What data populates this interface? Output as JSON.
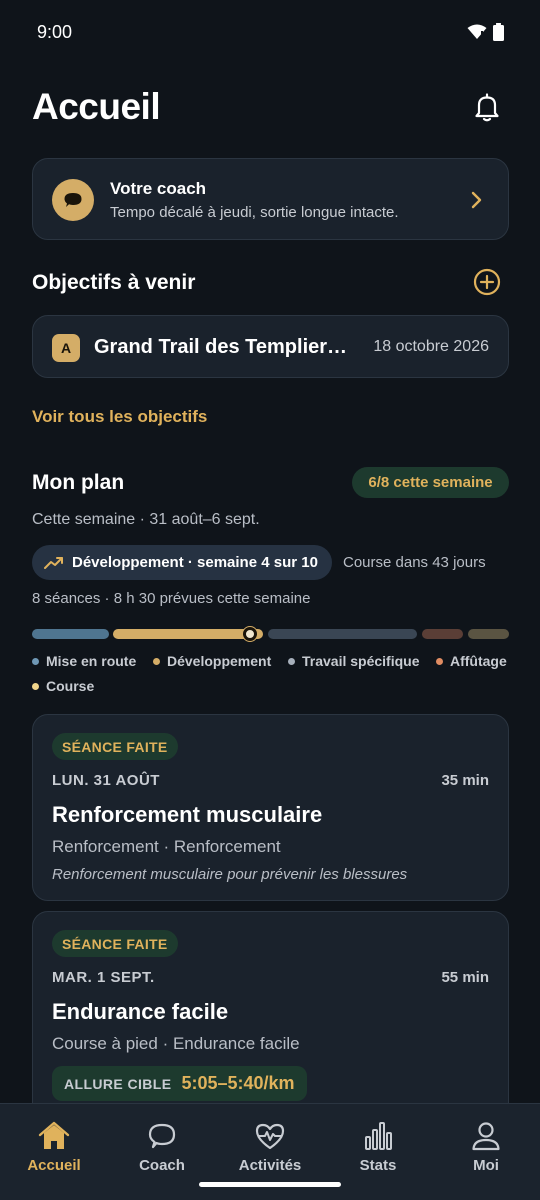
{
  "status_bar": {
    "time": "9:00"
  },
  "header": {
    "title": "Accueil"
  },
  "coach": {
    "title": "Votre coach",
    "message": "Tempo décalé à jeudi, sortie longue intacte."
  },
  "goals": {
    "title": "Objectifs à venir",
    "items": [
      {
        "badge": "A",
        "name": "Grand Trail des Templiers (…",
        "date": "18 octobre 2026"
      }
    ],
    "see_all": "Voir tous les objectifs"
  },
  "plan": {
    "title": "Mon plan",
    "week_progress": "6/8 cette semaine",
    "week_range": "Cette semaine · 31 août–6 sept.",
    "phase": "Développement · semaine 4 sur 10",
    "race_in": "Course dans 43 jours",
    "summary": "8 séances · 8 h 30 prévues cette semaine",
    "phase_colors": {
      "mise_en_route": "#4f7590",
      "developpement": "#d4ad67",
      "travail_specifique": "#3a4654",
      "affutage": "#5a3e36",
      "course": "#5a5442"
    },
    "legend": [
      {
        "label": "Mise en route",
        "color": "#6f98b5"
      },
      {
        "label": "Développement",
        "color": "#d4ad67"
      },
      {
        "label": "Travail spécifique",
        "color": "#a7b0bb"
      },
      {
        "label": "Affûtage",
        "color": "#e08c62"
      },
      {
        "label": "Course",
        "color": "#f0d48a"
      }
    ]
  },
  "sessions": [
    {
      "status": "SÉANCE FAITE",
      "date": "LUN. 31 AOÛT",
      "duration": "35 min",
      "title": "Renforcement musculaire",
      "subtitle": "Renforcement · Renforcement",
      "description": "Renforcement musculaire pour prévenir les blessures"
    },
    {
      "status": "SÉANCE FAITE",
      "date": "MAR. 1 SEPT.",
      "duration": "55 min",
      "title": "Endurance facile",
      "subtitle": "Course à pied · Endurance facile",
      "pace_label": "ALLURE CIBLE",
      "pace_value": "5:05–5:40/km"
    }
  ],
  "nav": {
    "items": [
      {
        "label": "Accueil",
        "icon": "home-icon",
        "active": true
      },
      {
        "label": "Coach",
        "icon": "chat-icon",
        "active": false
      },
      {
        "label": "Activités",
        "icon": "heart-pulse-icon",
        "active": false
      },
      {
        "label": "Stats",
        "icon": "bar-chart-icon",
        "active": false
      },
      {
        "label": "Moi",
        "icon": "user-icon",
        "active": false
      }
    ]
  },
  "colors": {
    "accent": "#e0b25c",
    "background": "#0f141a",
    "card": "#1a222c",
    "success_bg": "#1d3a2e"
  }
}
